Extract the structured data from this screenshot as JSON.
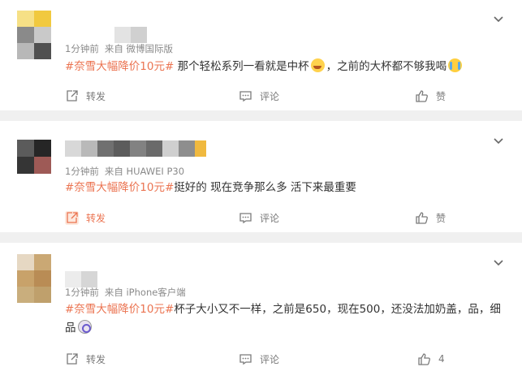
{
  "posts": [
    {
      "meta_time": "1分钟前",
      "meta_source": "来自 微博国际版",
      "hashtag": "#奈雪大幅降价10元#",
      "text_a": " 那个轻松系列一看就是中杯",
      "text_b": "，之前的大杯都不够我喝",
      "actions": {
        "repost": "转发",
        "comment": "评论",
        "like": "赞"
      },
      "avatar_colors": [
        "#f6e086",
        "#f1c93f",
        "#8a8a8a",
        "#c9c9c9",
        "#b8b8b8",
        "#505050"
      ],
      "name_colors": [
        "#e3e3e3",
        "#d0d0d0"
      ]
    },
    {
      "meta_time": "1分钟前",
      "meta_source": "来自 HUAWEI P30",
      "hashtag": "#奈雪大幅降价10元#",
      "text_a": "挺好的 现在竞争那么多 活下来最重要",
      "actions": {
        "repost": "转发",
        "comment": "评论",
        "like": "赞"
      },
      "avatar_colors": [
        "#5b5b5b",
        "#262626",
        "#353535",
        "#9e5a56"
      ],
      "name_colors": [
        "#d8d8d8",
        "#b9b9b9",
        "#707070",
        "#5c5c5c",
        "#828282",
        "#6a6a6a",
        "#cfcfcf",
        "#8e8e8e",
        "#f0b93f"
      ]
    },
    {
      "meta_time": "1分钟前",
      "meta_source": "来自 iPhone客户端",
      "hashtag": "#奈雪大幅降价10元#",
      "text_a": "杯子大小又不一样，之前是650，现在500，还没法加奶盖，品，细品",
      "actions": {
        "repost": "转发",
        "comment": "评论",
        "like": "4"
      },
      "avatar_colors": [
        "#e6d8c3",
        "#caa874",
        "#c8a26a",
        "#b98c55",
        "#c9ae7d",
        "#bfa06c"
      ],
      "name_colors": [
        "#ececec",
        "#d6d6d6"
      ]
    }
  ],
  "icons": [
    "chevron-down-icon",
    "repost-icon",
    "comment-icon",
    "like-icon",
    "emoji-laugh-icon",
    "emoji-cry-icon",
    "emoji-dizzy-icon"
  ],
  "colors": {
    "hashtag": "#eb7350",
    "meta": "#8a8a8a",
    "text": "#333333",
    "background": "#f0f0f0"
  }
}
